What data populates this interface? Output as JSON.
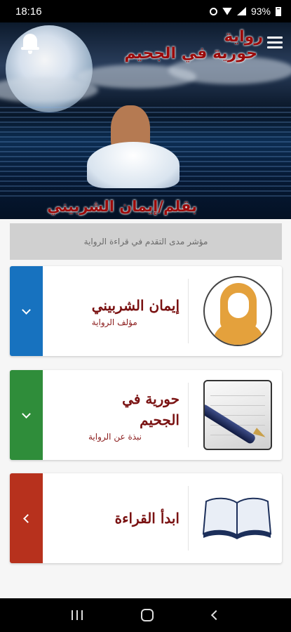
{
  "status_bar": {
    "time": "18:16",
    "battery": "93%"
  },
  "header": {
    "title_word": "رواية",
    "title_line": "حورية في الجحيم",
    "author_line": "بقلم/إيمان الشربيني"
  },
  "progress": {
    "label": "مؤشر مدى التقدم في قراءة الرواية"
  },
  "cards": [
    {
      "title": "إيمان الشربيني",
      "subtitle": "مؤلف الرواية",
      "accent": "#1772bf",
      "icon": "chevron-down-icon"
    },
    {
      "title": "حورية في الجحيم",
      "subtitle": "نبذة عن الرواية",
      "accent": "#2f8d3a",
      "icon": "chevron-down-icon"
    },
    {
      "title": "ابدأ القراءة",
      "subtitle": "",
      "accent": "#b7311d",
      "icon": "chevron-left-icon"
    }
  ],
  "colors": {
    "title_red": "#7a1212",
    "progress_bg": "#d0d0d0"
  }
}
